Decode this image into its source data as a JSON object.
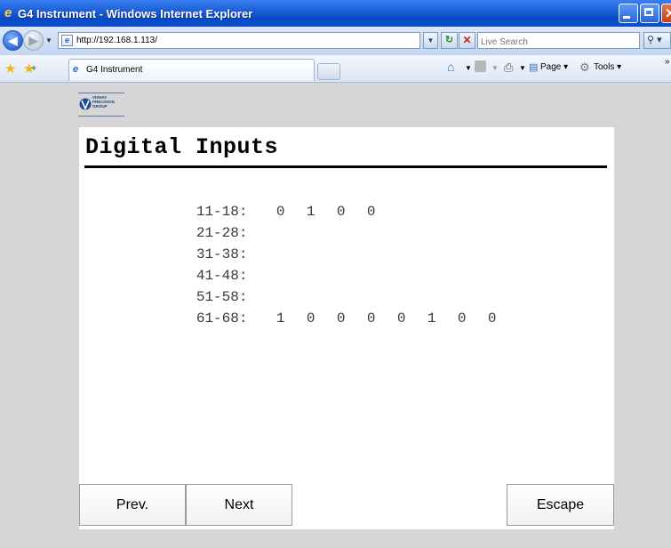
{
  "window": {
    "title": "G4 Instrument - Windows Internet Explorer"
  },
  "address_bar": {
    "url": "http://192.168.1.113/",
    "search_placeholder": "Live Search"
  },
  "tabs": [
    {
      "label": "G4 Instrument",
      "active": true
    }
  ],
  "command_bar": {
    "page_label": "Page",
    "tools_label": "Tools"
  },
  "logo": {
    "lines": [
      "VISHAY",
      "PRECISION",
      "GROUP"
    ]
  },
  "page": {
    "title": "Digital Inputs",
    "rows": [
      {
        "label": "11-18:",
        "bits": [
          "0",
          "1",
          "0",
          "0"
        ]
      },
      {
        "label": "21-28:",
        "bits": []
      },
      {
        "label": "31-38:",
        "bits": []
      },
      {
        "label": "41-48:",
        "bits": []
      },
      {
        "label": "51-58:",
        "bits": []
      },
      {
        "label": "61-68:",
        "bits": [
          "1",
          "0",
          "0",
          "0",
          "0",
          "1",
          "0",
          "0"
        ]
      }
    ]
  },
  "buttons": {
    "prev": "Prev.",
    "next": "Next",
    "escape": "Escape"
  },
  "colors": {
    "titlebar": "#0a49c4",
    "content_bg": "#d6d6d6",
    "panel_bg": "#ffffff"
  }
}
